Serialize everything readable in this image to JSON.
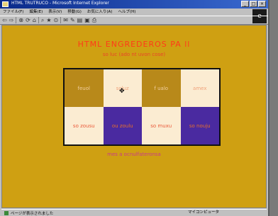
{
  "window": {
    "title": "HTML TRUTRUCO - Microsoft Internet Explorer",
    "buttons": [
      "_",
      "□",
      "×"
    ]
  },
  "menubar": {
    "items": [
      "ファイル(F)",
      "編集(E)",
      "表示(V)",
      "移動(G)",
      "お気に入り(A)",
      "ヘルプ(H)"
    ]
  },
  "toolbar": {
    "buttons": [
      "⇦",
      "⇨",
      "⊗",
      "⟳",
      "⌂",
      "⌕",
      "★",
      "⊙",
      "✉",
      "✎",
      "▤",
      "▣",
      "⎙"
    ]
  },
  "brand": {
    "text": "e"
  },
  "page": {
    "title": "HTML ENGREDEROS PA ll",
    "subtitle": "so luc (ado nt uvon cose)",
    "footer": "mes a ocnulfateronsa",
    "cells": [
      {
        "text": "feuol"
      },
      {
        "text": "soluz"
      },
      {
        "text": "f ualo"
      },
      {
        "text": "amex"
      },
      {
        "text": "so zousu"
      },
      {
        "text": "ou zoulu"
      },
      {
        "text": "so muxu"
      },
      {
        "text": "so nouju"
      }
    ]
  },
  "status": {
    "left": "ページが表示されました",
    "zone": "マイコンピュータ"
  }
}
